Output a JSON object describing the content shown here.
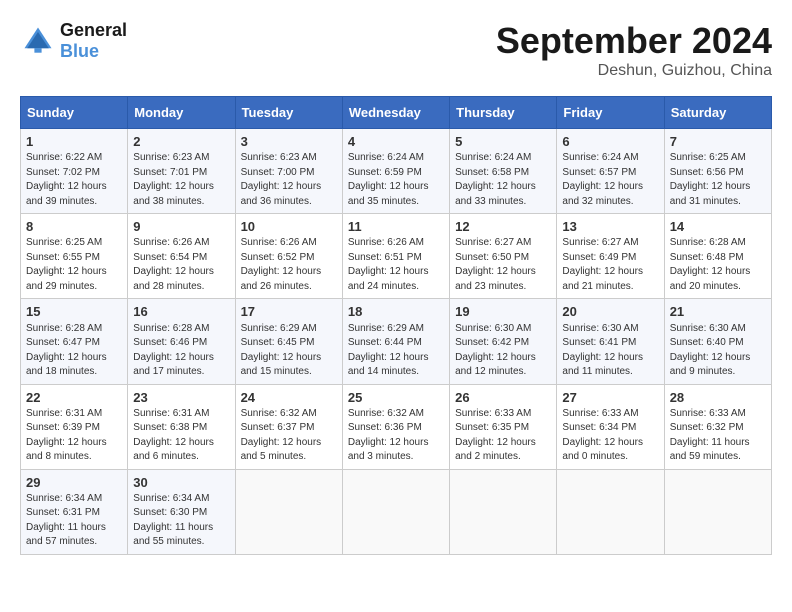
{
  "header": {
    "logo_line1": "General",
    "logo_line2": "Blue",
    "month_title": "September 2024",
    "location": "Deshun, Guizhou, China"
  },
  "days_of_week": [
    "Sunday",
    "Monday",
    "Tuesday",
    "Wednesday",
    "Thursday",
    "Friday",
    "Saturday"
  ],
  "weeks": [
    [
      {
        "day": "1",
        "sunrise": "6:22 AM",
        "sunset": "7:02 PM",
        "daylight": "12 hours and 39 minutes."
      },
      {
        "day": "2",
        "sunrise": "6:23 AM",
        "sunset": "7:01 PM",
        "daylight": "12 hours and 38 minutes."
      },
      {
        "day": "3",
        "sunrise": "6:23 AM",
        "sunset": "7:00 PM",
        "daylight": "12 hours and 36 minutes."
      },
      {
        "day": "4",
        "sunrise": "6:24 AM",
        "sunset": "6:59 PM",
        "daylight": "12 hours and 35 minutes."
      },
      {
        "day": "5",
        "sunrise": "6:24 AM",
        "sunset": "6:58 PM",
        "daylight": "12 hours and 33 minutes."
      },
      {
        "day": "6",
        "sunrise": "6:24 AM",
        "sunset": "6:57 PM",
        "daylight": "12 hours and 32 minutes."
      },
      {
        "day": "7",
        "sunrise": "6:25 AM",
        "sunset": "6:56 PM",
        "daylight": "12 hours and 31 minutes."
      }
    ],
    [
      {
        "day": "8",
        "sunrise": "6:25 AM",
        "sunset": "6:55 PM",
        "daylight": "12 hours and 29 minutes."
      },
      {
        "day": "9",
        "sunrise": "6:26 AM",
        "sunset": "6:54 PM",
        "daylight": "12 hours and 28 minutes."
      },
      {
        "day": "10",
        "sunrise": "6:26 AM",
        "sunset": "6:52 PM",
        "daylight": "12 hours and 26 minutes."
      },
      {
        "day": "11",
        "sunrise": "6:26 AM",
        "sunset": "6:51 PM",
        "daylight": "12 hours and 24 minutes."
      },
      {
        "day": "12",
        "sunrise": "6:27 AM",
        "sunset": "6:50 PM",
        "daylight": "12 hours and 23 minutes."
      },
      {
        "day": "13",
        "sunrise": "6:27 AM",
        "sunset": "6:49 PM",
        "daylight": "12 hours and 21 minutes."
      },
      {
        "day": "14",
        "sunrise": "6:28 AM",
        "sunset": "6:48 PM",
        "daylight": "12 hours and 20 minutes."
      }
    ],
    [
      {
        "day": "15",
        "sunrise": "6:28 AM",
        "sunset": "6:47 PM",
        "daylight": "12 hours and 18 minutes."
      },
      {
        "day": "16",
        "sunrise": "6:28 AM",
        "sunset": "6:46 PM",
        "daylight": "12 hours and 17 minutes."
      },
      {
        "day": "17",
        "sunrise": "6:29 AM",
        "sunset": "6:45 PM",
        "daylight": "12 hours and 15 minutes."
      },
      {
        "day": "18",
        "sunrise": "6:29 AM",
        "sunset": "6:44 PM",
        "daylight": "12 hours and 14 minutes."
      },
      {
        "day": "19",
        "sunrise": "6:30 AM",
        "sunset": "6:42 PM",
        "daylight": "12 hours and 12 minutes."
      },
      {
        "day": "20",
        "sunrise": "6:30 AM",
        "sunset": "6:41 PM",
        "daylight": "12 hours and 11 minutes."
      },
      {
        "day": "21",
        "sunrise": "6:30 AM",
        "sunset": "6:40 PM",
        "daylight": "12 hours and 9 minutes."
      }
    ],
    [
      {
        "day": "22",
        "sunrise": "6:31 AM",
        "sunset": "6:39 PM",
        "daylight": "12 hours and 8 minutes."
      },
      {
        "day": "23",
        "sunrise": "6:31 AM",
        "sunset": "6:38 PM",
        "daylight": "12 hours and 6 minutes."
      },
      {
        "day": "24",
        "sunrise": "6:32 AM",
        "sunset": "6:37 PM",
        "daylight": "12 hours and 5 minutes."
      },
      {
        "day": "25",
        "sunrise": "6:32 AM",
        "sunset": "6:36 PM",
        "daylight": "12 hours and 3 minutes."
      },
      {
        "day": "26",
        "sunrise": "6:33 AM",
        "sunset": "6:35 PM",
        "daylight": "12 hours and 2 minutes."
      },
      {
        "day": "27",
        "sunrise": "6:33 AM",
        "sunset": "6:34 PM",
        "daylight": "12 hours and 0 minutes."
      },
      {
        "day": "28",
        "sunrise": "6:33 AM",
        "sunset": "6:32 PM",
        "daylight": "11 hours and 59 minutes."
      }
    ],
    [
      {
        "day": "29",
        "sunrise": "6:34 AM",
        "sunset": "6:31 PM",
        "daylight": "11 hours and 57 minutes."
      },
      {
        "day": "30",
        "sunrise": "6:34 AM",
        "sunset": "6:30 PM",
        "daylight": "11 hours and 55 minutes."
      },
      null,
      null,
      null,
      null,
      null
    ]
  ],
  "labels": {
    "sunrise": "Sunrise: ",
    "sunset": "Sunset: ",
    "daylight": "Daylight: "
  }
}
